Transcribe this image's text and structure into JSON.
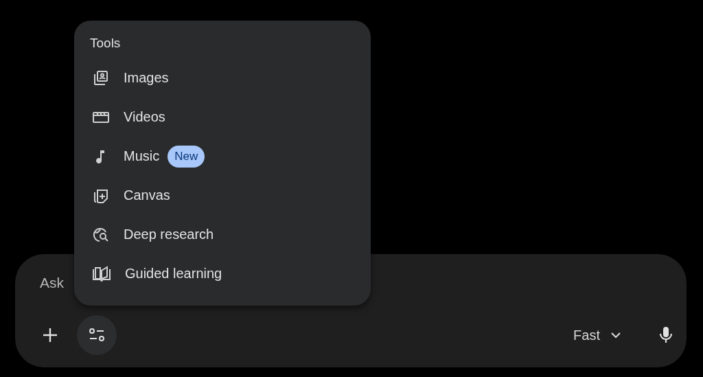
{
  "menu": {
    "title": "Tools",
    "items": [
      {
        "label": "Images"
      },
      {
        "label": "Videos"
      },
      {
        "label": "Music",
        "badge": "New"
      },
      {
        "label": "Canvas"
      },
      {
        "label": "Deep research"
      },
      {
        "label": "Guided learning"
      }
    ]
  },
  "prompt": {
    "placeholder": "Ask"
  },
  "model": {
    "label": "Fast"
  }
}
